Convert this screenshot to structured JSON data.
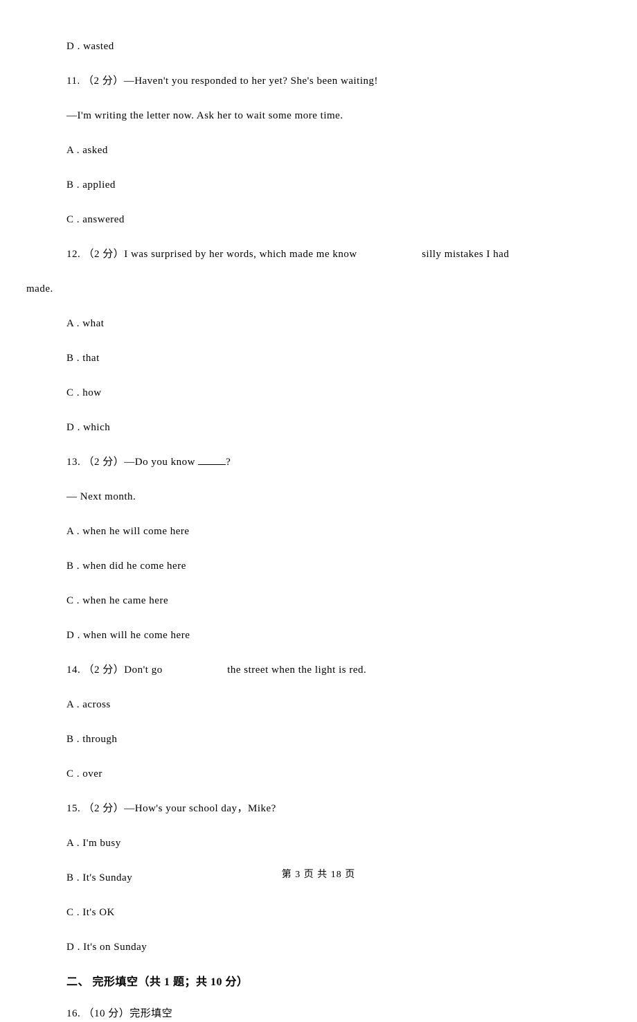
{
  "q10": {
    "d": "D . wasted"
  },
  "q11": {
    "stem": "11. （2 分）—Haven't you responded to her yet? She's been waiting!",
    "line2": "—I'm writing the letter now. Ask her to wait some more time.",
    "a": "A . asked",
    "b": "B . applied",
    "c": "C . answered"
  },
  "q12": {
    "stem_pre": "12. （2 分）I was surprised by her words, which made me know ",
    "stem_post": " silly mistakes I had",
    "cont": "made.",
    "a": "A . what",
    "b": "B . that",
    "c": "C . how",
    "d": "D . which"
  },
  "q13": {
    "stem_pre": "13. （2 分）—Do you know ",
    "stem_post": "?",
    "line2": "— Next month.",
    "a": "A . when he will come here",
    "b": "B . when did he come here",
    "c": "C . when he came here",
    "d": "D . when will he come here"
  },
  "q14": {
    "stem_pre": "14. （2 分）Don't go ",
    "stem_post": " the street when the light is red.",
    "a": "A . across",
    "b": "B . through",
    "c": "C . over"
  },
  "q15": {
    "stem": "15. （2 分）—How's your school day，Mike?",
    "a": "A . I'm busy",
    "b": "B . It's Sunday",
    "c": "C . It's OK",
    "d": "D . It's on Sunday"
  },
  "section2": "二、 完形填空（共 1 题；共 10 分）",
  "q16": {
    "stem": "16. （10 分）完形填空"
  },
  "footer": "第 3 页 共 18 页"
}
